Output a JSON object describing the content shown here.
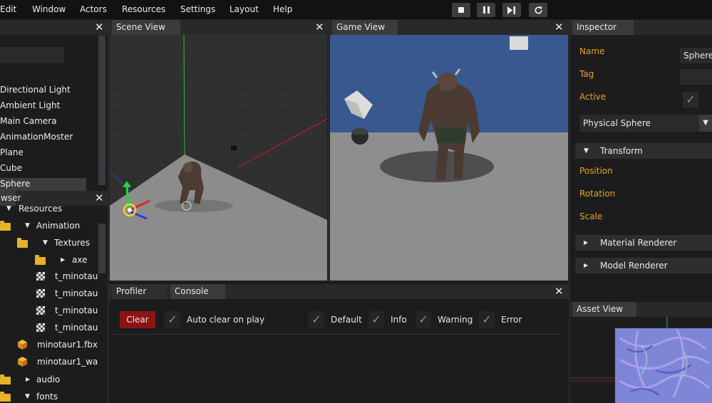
{
  "menu": {
    "items": [
      "Edit",
      "Window",
      "Actors",
      "Resources",
      "Settings",
      "Layout",
      "Help"
    ]
  },
  "toolbar": {
    "stop": "■",
    "pause": "❚❚",
    "step": "▶❚",
    "reload": "↻"
  },
  "hierarchy": {
    "items": [
      "Directional Light",
      "Ambient Light",
      "Main Camera",
      "AnimationMoster",
      "Plane",
      "Cube",
      "Sphere"
    ],
    "selected": "Sphere"
  },
  "browser": {
    "title": "wser",
    "items": [
      {
        "name": "Resources",
        "icon": "folder-icon",
        "arrow": "▼"
      },
      {
        "name": "Animation",
        "icon": "folder-icon",
        "arrow": "▼"
      },
      {
        "name": "Textures",
        "icon": "folder-icon",
        "arrow": "▼"
      },
      {
        "name": "axe",
        "icon": "folder-icon",
        "arrow": "▶"
      },
      {
        "name": "t_minotau",
        "icon": "texture-icon",
        "arrow": ""
      },
      {
        "name": "t_minotau",
        "icon": "texture-icon",
        "arrow": ""
      },
      {
        "name": "t_minotau",
        "icon": "texture-icon",
        "arrow": ""
      },
      {
        "name": "t_minotau",
        "icon": "texture-icon",
        "arrow": ""
      },
      {
        "name": "minotaur1.fbx",
        "icon": "model-icon",
        "arrow": ""
      },
      {
        "name": "minotaur1_wa",
        "icon": "model-icon",
        "arrow": ""
      },
      {
        "name": "audio",
        "icon": "folder-icon",
        "arrow": "▶"
      },
      {
        "name": "fonts",
        "icon": "folder-icon",
        "arrow": "▼"
      }
    ]
  },
  "scene_view": {
    "title": "Scene View"
  },
  "game_view": {
    "title": "Game View"
  },
  "inspector": {
    "title": "Inspector",
    "name_label": "Name",
    "name_value": "Sphere",
    "tag_label": "Tag",
    "active_label": "Active",
    "component_select": "Physical Sphere",
    "transform": "Transform",
    "position": "Position",
    "rotation": "Rotation",
    "scale": "Scale",
    "material_renderer": "Material Renderer",
    "model_renderer": "Model Renderer"
  },
  "console": {
    "tabs": [
      "Profiler",
      "Console"
    ],
    "active_tab": "Console",
    "clear_button": "Clear",
    "auto_clear": "Auto clear on play",
    "filters": [
      "Default",
      "Info",
      "Warning",
      "Error"
    ]
  },
  "asset_view": {
    "title": "Asset View"
  },
  "colors": {
    "accent_gold": "#e4a41f",
    "clear_red": "#8b1414",
    "sky_blue": "#38588f"
  }
}
